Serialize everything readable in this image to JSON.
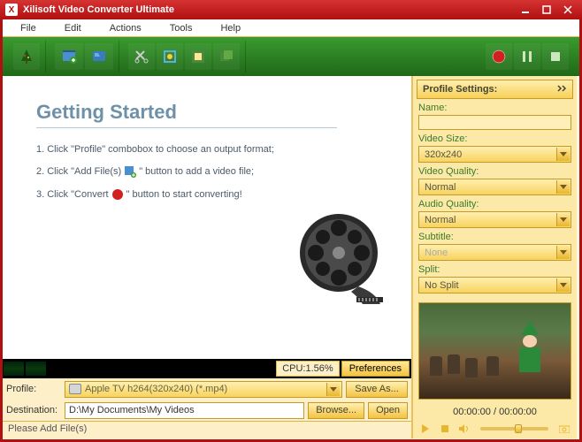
{
  "window": {
    "title": "Xilisoft Video Converter Ultimate"
  },
  "menu": {
    "file": "File",
    "edit": "Edit",
    "actions": "Actions",
    "tools": "Tools",
    "help": "Help"
  },
  "getting_started": {
    "heading": "Getting Started",
    "step1a": "1. Click \"Profile\" combobox to choose an output format;",
    "step2a": "2. Click \"Add File(s)",
    "step2b": "\" button to add a video file;",
    "step3a": "3. Click \"Convert",
    "step3b": "\" button to start converting!"
  },
  "cpu": {
    "label": "CPU:",
    "value": "1.56%"
  },
  "buttons": {
    "preferences": "Preferences",
    "save_as": "Save As...",
    "browse": "Browse...",
    "open": "Open"
  },
  "form": {
    "profile_label": "Profile:",
    "profile_value": "Apple TV h264(320x240) (*.mp4)",
    "destination_label": "Destination:",
    "destination_value": "D:\\My Documents\\My Videos"
  },
  "status": {
    "message": "Please Add File(s)"
  },
  "profile_settings": {
    "header": "Profile Settings:",
    "name_label": "Name:",
    "name_value": "",
    "video_size_label": "Video Size:",
    "video_size_value": "320x240",
    "video_quality_label": "Video Quality:",
    "video_quality_value": "Normal",
    "audio_quality_label": "Audio Quality:",
    "audio_quality_value": "Normal",
    "subtitle_label": "Subtitle:",
    "subtitle_value": "None",
    "split_label": "Split:",
    "split_value": "No Split"
  },
  "player": {
    "time": "00:00:00 / 00:00:00"
  }
}
